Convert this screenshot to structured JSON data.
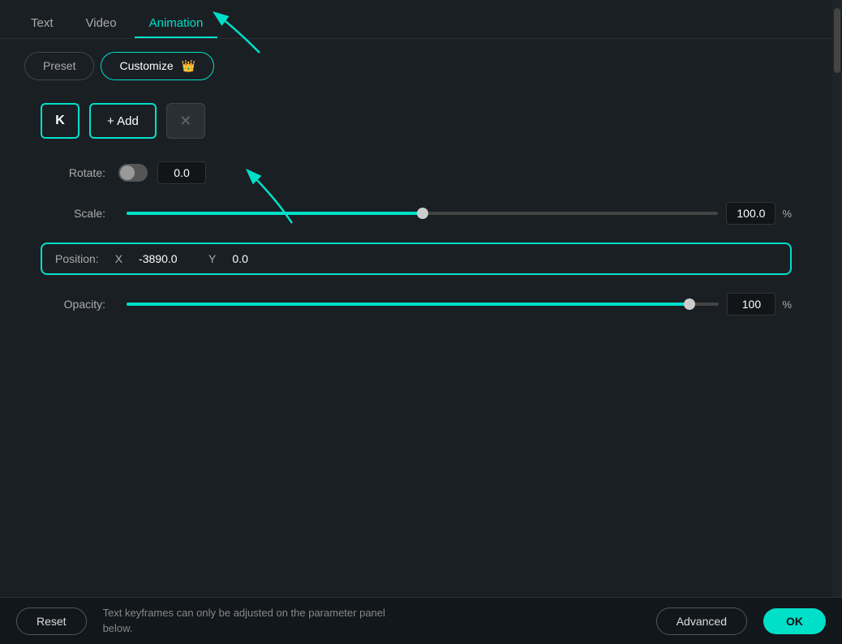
{
  "tabs": {
    "items": [
      {
        "label": "Text",
        "active": false
      },
      {
        "label": "Video",
        "active": false
      },
      {
        "label": "Animation",
        "active": true
      }
    ]
  },
  "sub_tabs": {
    "preset": {
      "label": "Preset",
      "active": false
    },
    "customize": {
      "label": "Customize",
      "active": true,
      "icon": "👑"
    }
  },
  "keyframe": {
    "k_label": "K",
    "add_label": "+ Add",
    "delete_label": "✕"
  },
  "rotate": {
    "label": "Rotate:",
    "value": "0.0"
  },
  "scale": {
    "label": "Scale:",
    "value": "100.0",
    "unit": "%",
    "percent": 50
  },
  "position": {
    "label": "Position:",
    "x_label": "X",
    "x_value": "-3890.0",
    "y_label": "Y",
    "y_value": "0.0"
  },
  "opacity": {
    "label": "Opacity:",
    "value": "100",
    "unit": "%",
    "percent": 95
  },
  "bottom": {
    "reset_label": "Reset",
    "message": "Text keyframes can only be adjusted on the parameter panel\nbelow.",
    "advanced_label": "Advanced",
    "ok_label": "OK"
  }
}
